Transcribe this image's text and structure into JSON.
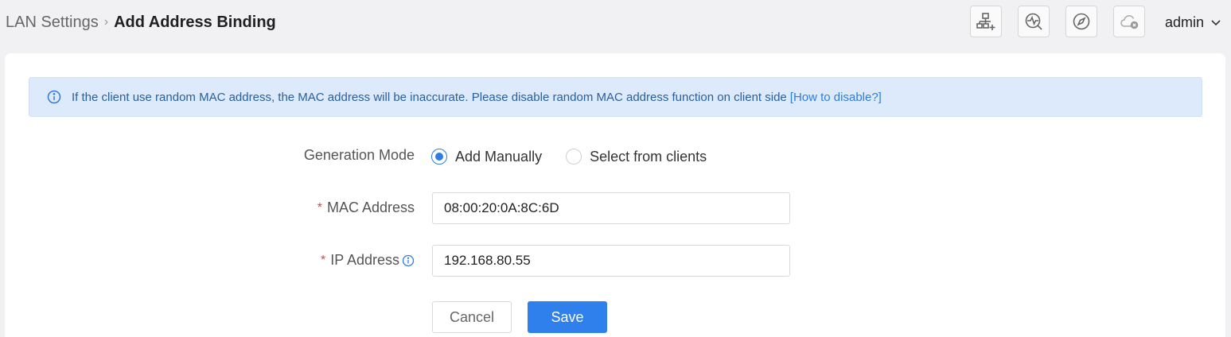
{
  "breadcrumb": {
    "parent": "LAN Settings",
    "separator": ">",
    "current": "Add Address Binding"
  },
  "header": {
    "icons": [
      "network-add-icon",
      "diagnose-icon",
      "compass-icon",
      "cloud-offline-icon"
    ],
    "user": "admin"
  },
  "alert": {
    "message": "If the client use random MAC address, the MAC address will be inaccurate. Please disable random MAC address function on client side",
    "link": "[How to disable?]"
  },
  "form": {
    "generation_mode": {
      "label": "Generation Mode",
      "options": [
        "Add Manually",
        "Select from clients"
      ],
      "selected": "Add Manually"
    },
    "mac": {
      "required_mark": "*",
      "label": "MAC Address",
      "value": "08:00:20:0A:8C:6D"
    },
    "ip": {
      "required_mark": "*",
      "label": "IP Address",
      "value": "192.168.80.55"
    }
  },
  "buttons": {
    "cancel": "Cancel",
    "save": "Save"
  },
  "colors": {
    "accent": "#2f80ed",
    "alert_bg": "#dceafb",
    "required": "#e0453a"
  }
}
